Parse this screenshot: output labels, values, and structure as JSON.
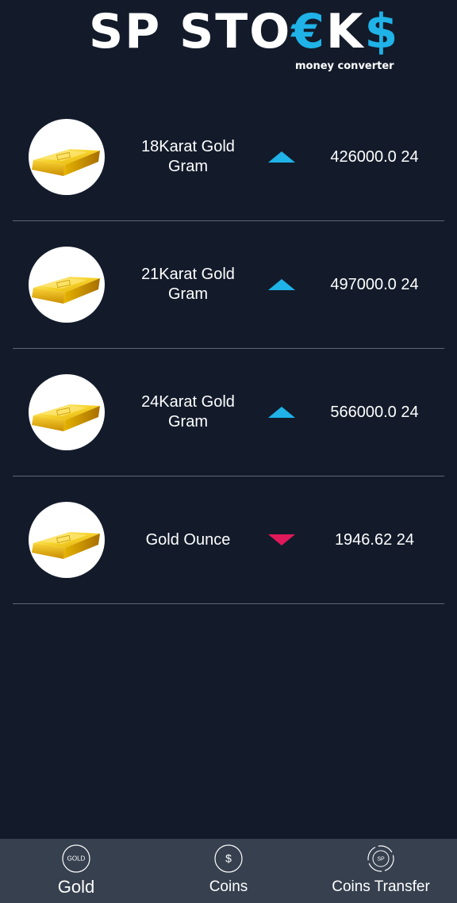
{
  "app": {
    "logo": {
      "part1": "SP STO",
      "part2": "€",
      "part3": "K",
      "part4": "$",
      "subtitle": "money converter"
    }
  },
  "colors": {
    "background": "#131b2b",
    "nav_background": "#36404f",
    "up": "#1fb3e8",
    "down": "#e0195a",
    "divider": "#5d6472"
  },
  "items": [
    {
      "icon": "gold-bar-icon",
      "name": "18Karat Gold Gram",
      "trend": "up",
      "price": "426000.0 24"
    },
    {
      "icon": "gold-bar-icon",
      "name": "21Karat Gold Gram",
      "trend": "up",
      "price": "497000.0 24"
    },
    {
      "icon": "gold-bar-icon",
      "name": "24Karat Gold Gram",
      "trend": "up",
      "price": "566000.0 24"
    },
    {
      "icon": "gold-bar-icon",
      "name": "Gold Ounce",
      "trend": "down",
      "price": "1946.62 24"
    }
  ],
  "nav": {
    "items": [
      {
        "label": "Gold",
        "icon": "gold-coin-icon",
        "icon_text": "GOLD",
        "active": true
      },
      {
        "label": "Coins",
        "icon": "dollar-coin-icon",
        "icon_text": "$",
        "active": false
      },
      {
        "label": "Coins Transfer",
        "icon": "sp-transfer-icon",
        "icon_text": "SP",
        "active": false
      }
    ]
  }
}
